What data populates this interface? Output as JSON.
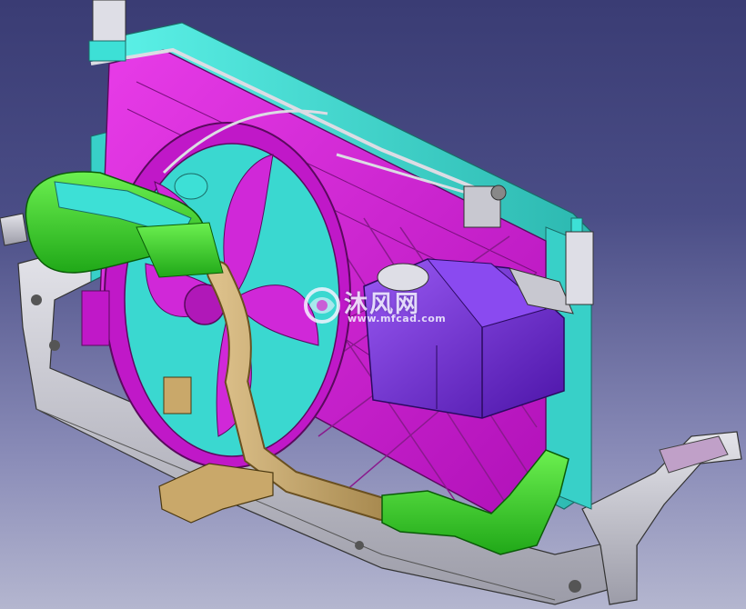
{
  "watermark": {
    "title": "沐风网",
    "url": "www.mfcad.com"
  },
  "colors": {
    "background_top": "#3a3c74",
    "background_bottom": "#b4b6cf",
    "radiator": "#d21bd6",
    "frame": "#3de0d6",
    "hose_green": "#3fe02a",
    "tank": "#7a2ee0",
    "pipe": "#c9a86a",
    "bracket": "#c8c8cc"
  },
  "icons": {
    "watermark_logo": "mfcad-logo-icon"
  }
}
